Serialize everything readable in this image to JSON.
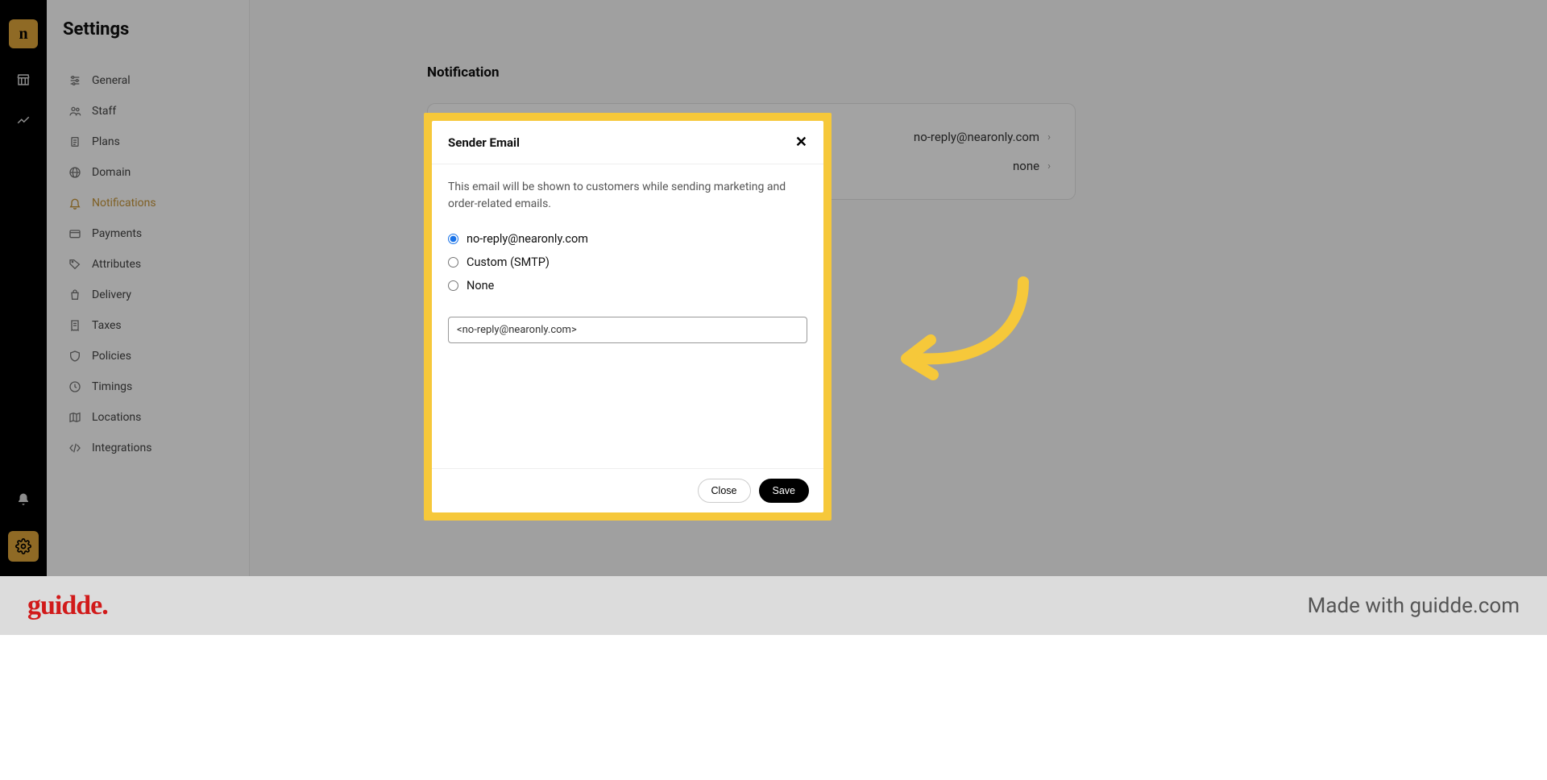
{
  "rail": {
    "logo_letter": "n"
  },
  "settings": {
    "title": "Settings",
    "items": [
      {
        "label": "General",
        "icon": "sliders"
      },
      {
        "label": "Staff",
        "icon": "users"
      },
      {
        "label": "Plans",
        "icon": "clipboard"
      },
      {
        "label": "Domain",
        "icon": "globe"
      },
      {
        "label": "Notifications",
        "icon": "bell",
        "active": true
      },
      {
        "label": "Payments",
        "icon": "wallet"
      },
      {
        "label": "Attributes",
        "icon": "tag"
      },
      {
        "label": "Delivery",
        "icon": "bag"
      },
      {
        "label": "Taxes",
        "icon": "receipt"
      },
      {
        "label": "Policies",
        "icon": "shield"
      },
      {
        "label": "Timings",
        "icon": "clock"
      },
      {
        "label": "Locations",
        "icon": "map"
      },
      {
        "label": "Integrations",
        "icon": "code"
      }
    ]
  },
  "main": {
    "section_title": "Notification",
    "rows": [
      {
        "value": "no-reply@nearonly.com"
      },
      {
        "value": "none"
      }
    ]
  },
  "modal": {
    "title": "Sender Email",
    "description": "This email will be shown to customers while sending marketing and order-related emails.",
    "options": [
      {
        "label": "no-reply@nearonly.com",
        "checked": true
      },
      {
        "label": "Custom (SMTP)",
        "checked": false
      },
      {
        "label": "None",
        "checked": false
      }
    ],
    "input_value": "<no-reply@nearonly.com>",
    "close_label": "Close",
    "save_label": "Save"
  },
  "banner": {
    "brand": "guidde.",
    "madewith": "Made with guidde.com"
  },
  "colors": {
    "accent": "#e0a73a",
    "highlight": "#f6c83a"
  }
}
